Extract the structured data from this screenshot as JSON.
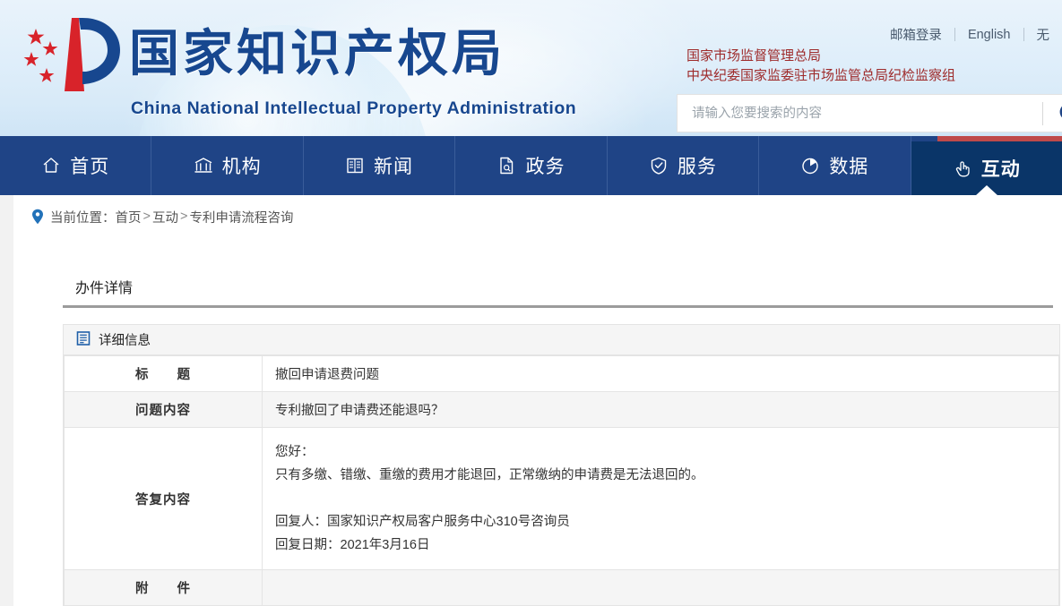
{
  "header": {
    "logo_cn": "国家知识产权局",
    "logo_en": "China National Intellectual Property Administration",
    "top_links": [
      {
        "label": "邮箱登录"
      },
      {
        "label": "English"
      },
      {
        "label": "无"
      }
    ],
    "red_links": [
      "国家市场监督管理总局",
      "中央纪委国家监委驻市场监管总局纪检监察组"
    ],
    "search": {
      "placeholder": "请输入您要搜索的内容",
      "value": "",
      "icon": "search-icon"
    }
  },
  "nav": {
    "items": [
      {
        "label": "首页",
        "icon": "home-icon",
        "active": false
      },
      {
        "label": "机构",
        "icon": "bank-icon",
        "active": false
      },
      {
        "label": "新闻",
        "icon": "newspaper-icon",
        "active": false
      },
      {
        "label": "政务",
        "icon": "document-search-icon",
        "active": false
      },
      {
        "label": "服务",
        "icon": "shield-check-icon",
        "active": false
      },
      {
        "label": "数据",
        "icon": "pie-chart-icon",
        "active": false
      },
      {
        "label": "互动",
        "icon": "hand-pointer-icon",
        "active": true
      }
    ]
  },
  "breadcrumb": {
    "prefix": "当前位置：",
    "items": [
      "首页",
      "互动",
      "专利申请流程咨询"
    ],
    "separator": ">",
    "icon": "location-pin-icon"
  },
  "main": {
    "tabs": [
      {
        "label": "办件详情",
        "active": true
      }
    ],
    "panel_title": "详细信息",
    "panel_icon": "list-document-icon",
    "rows": [
      {
        "label": "标　　题",
        "value": "撤回申请退费问题",
        "shade": false
      },
      {
        "label": "问题内容",
        "value": "专利撤回了申请费还能退吗？",
        "shade": true
      },
      {
        "label": "答复内容",
        "shade": false,
        "lines": [
          "您好：",
          "只有多缴、错缴、重缴的费用才能退回，正常缴纳的申请费是无法退回的。",
          "",
          "回复人：国家知识产权局客户服务中心310号咨询员",
          "回复日期：2021年3月16日"
        ]
      },
      {
        "label": "附　　件",
        "value": "",
        "shade": true
      }
    ]
  },
  "colors": {
    "brand_blue": "#17478f",
    "nav_blue": "#1f4486",
    "nav_active_blue": "#0a3568",
    "accent_red": "#bf4a4a",
    "link_red": "#9e2b2b",
    "row_shade": "#f5f5f5"
  }
}
